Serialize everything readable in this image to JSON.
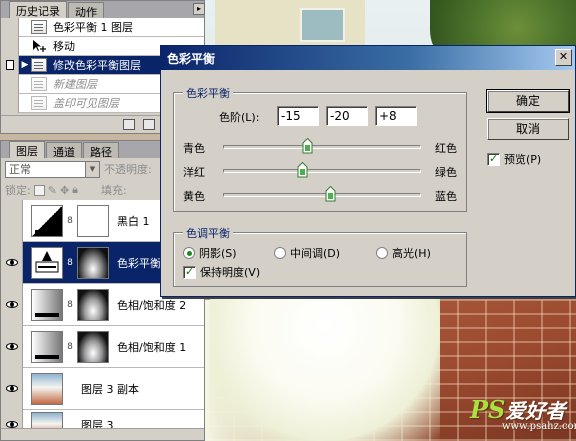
{
  "history_panel": {
    "tabs": [
      "历史记录",
      "动作"
    ],
    "items": [
      {
        "label": "色彩平衡 1 图层",
        "state": "normal",
        "icon": "document-icon"
      },
      {
        "label": "移动",
        "state": "normal",
        "icon": "move-tool-icon"
      },
      {
        "label": "修改色彩平衡图层",
        "state": "selected",
        "icon": "document-icon"
      },
      {
        "label": "新建图层",
        "state": "dimmed",
        "icon": "document-icon"
      },
      {
        "label": "盖印可见图层",
        "state": "dimmed",
        "icon": "document-icon"
      }
    ]
  },
  "layers_panel": {
    "tabs": [
      "图层",
      "通道",
      "路径"
    ],
    "blend_mode": "正常",
    "opacity_label": "不透明度:",
    "lock_label": "锁定:",
    "fill_label": "填充:",
    "layers": [
      {
        "name": "黑白 1",
        "visible": false,
        "selected": false,
        "has_mask": true
      },
      {
        "name": "色彩平衡",
        "visible": true,
        "selected": true,
        "has_mask": true
      },
      {
        "name": "色相/饱和度 2",
        "visible": true,
        "selected": false,
        "has_mask": true
      },
      {
        "name": "色相/饱和度 1",
        "visible": true,
        "selected": false,
        "has_mask": true
      },
      {
        "name": "图层 3 副本",
        "visible": true,
        "selected": false,
        "has_mask": false
      },
      {
        "name": "图层 3",
        "visible": true,
        "selected": false,
        "has_mask": false
      }
    ]
  },
  "dialog": {
    "title": "色彩平衡",
    "color_balance_group": {
      "legend": "色彩平衡",
      "levels_label": "色阶(L):",
      "levels": [
        "-15",
        "-20",
        "+8"
      ],
      "sliders": [
        {
          "left": "青色",
          "right": "红色",
          "value": -15
        },
        {
          "left": "洋红",
          "right": "绿色",
          "value": -20
        },
        {
          "left": "黄色",
          "right": "蓝色",
          "value": 8
        }
      ],
      "slider_range": [
        -100,
        100
      ]
    },
    "tone_balance_group": {
      "legend": "色调平衡",
      "options": [
        {
          "label": "阴影(S)",
          "selected": true
        },
        {
          "label": "中间调(D)",
          "selected": false
        },
        {
          "label": "高光(H)",
          "selected": false
        }
      ],
      "preserve_luminosity": {
        "label": "保持明度(V)",
        "checked": true
      }
    },
    "buttons": {
      "ok": "确定",
      "cancel": "取消"
    },
    "preview": {
      "label": "预览(P)",
      "checked": true
    }
  },
  "watermark": {
    "logo": "PS爱好者",
    "url": "www.psahz.com"
  }
}
